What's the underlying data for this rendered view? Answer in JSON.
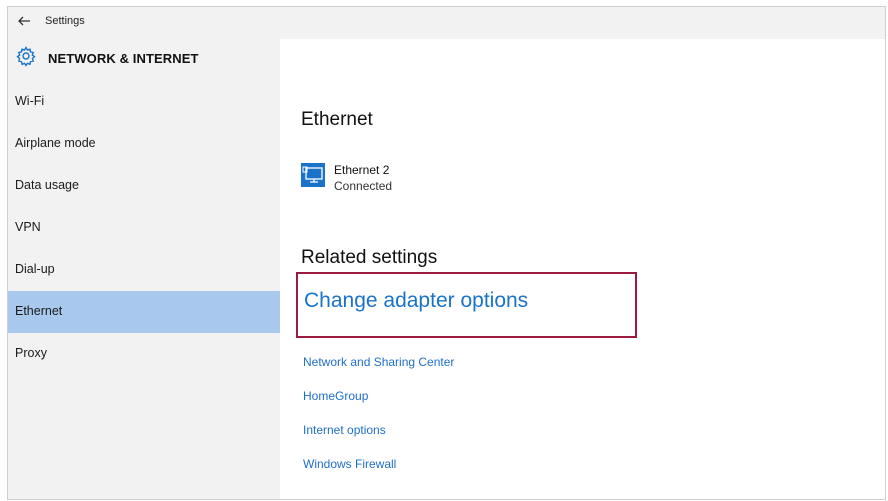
{
  "window": {
    "title": "Settings"
  },
  "header": {
    "section_title": "NETWORK & INTERNET"
  },
  "sidebar": {
    "items": [
      {
        "label": "Wi-Fi"
      },
      {
        "label": "Airplane mode"
      },
      {
        "label": "Data usage"
      },
      {
        "label": "VPN"
      },
      {
        "label": "Dial-up"
      },
      {
        "label": "Ethernet",
        "active": true
      },
      {
        "label": "Proxy"
      }
    ]
  },
  "main": {
    "heading": "Ethernet",
    "device": {
      "name": "Ethernet 2",
      "status": "Connected",
      "icon": "ethernet-monitor-icon"
    },
    "related_heading": "Related settings",
    "primary_link": "Change adapter options",
    "links": [
      "Network and Sharing Center",
      "HomeGroup",
      "Internet options",
      "Windows Firewall"
    ]
  },
  "colors": {
    "accent": "#1a73c8",
    "active_nav": "#a8c9ed",
    "highlight_border": "#9b1b3f",
    "sidebar_bg": "#f2f2f2"
  }
}
